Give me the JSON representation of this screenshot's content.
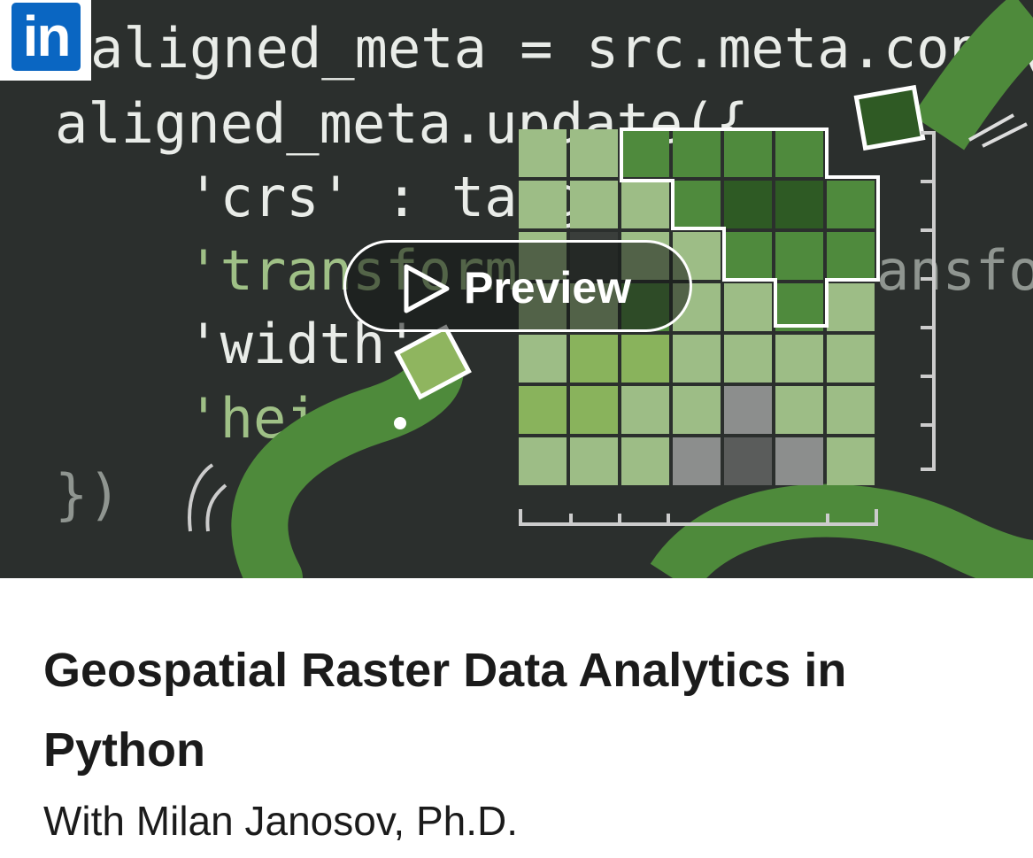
{
  "thumbnail": {
    "code_lines": [
      "aligned_meta = src.meta.copy()",
      "aligned_meta.update({",
      "    'crs' : targ",
      "    'transform'",
      "    'width'",
      "    'heig",
      "})",
      "ansfor"
    ],
    "logo_text": "in",
    "preview_label": "Preview"
  },
  "course": {
    "title": "Geospatial Raster Data Analytics in Python",
    "author": "With Milan Janosov, Ph.D."
  },
  "colors": {
    "brand": "#0a66c2",
    "background": "#2b2f2d",
    "text": "#1b1b1b"
  }
}
